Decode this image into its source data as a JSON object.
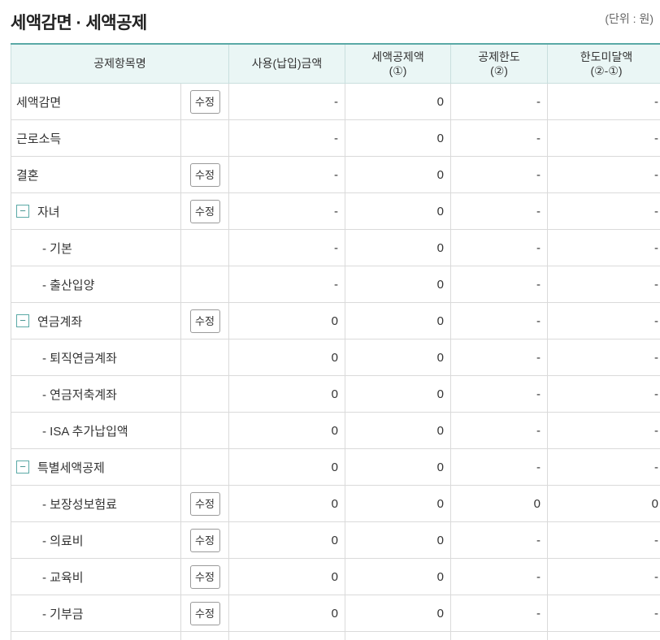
{
  "header": {
    "title": "세액감면 · 세액공제",
    "unit": "(단위 : 원)"
  },
  "table": {
    "columns": {
      "item": "공제항목명",
      "paid": "사용(납입)금액",
      "credit": "세액공제액",
      "credit_note": "(①)",
      "limit": "공제한도",
      "limit_note": "(②)",
      "remaining": "한도미달액",
      "remaining_note": "(②-①)"
    },
    "edit_label": "수정",
    "toggle_symbol": "−",
    "rows": [
      {
        "label": "세액감면",
        "paid": "-",
        "credit": "0",
        "limit": "-",
        "remaining": "-"
      },
      {
        "label": "근로소득",
        "paid": "-",
        "credit": "0",
        "limit": "-",
        "remaining": "-"
      },
      {
        "label": "결혼",
        "paid": "-",
        "credit": "0",
        "limit": "-",
        "remaining": "-"
      },
      {
        "label": "자녀",
        "paid": "-",
        "credit": "0",
        "limit": "-",
        "remaining": "-"
      },
      {
        "label": "- 기본",
        "paid": "-",
        "credit": "0",
        "limit": "-",
        "remaining": "-"
      },
      {
        "label": "- 출산입양",
        "paid": "-",
        "credit": "0",
        "limit": "-",
        "remaining": "-"
      },
      {
        "label": "연금계좌",
        "paid": "0",
        "credit": "0",
        "limit": "-",
        "remaining": "-"
      },
      {
        "label": "- 퇴직연금계좌",
        "paid": "0",
        "credit": "0",
        "limit": "-",
        "remaining": "-"
      },
      {
        "label": "- 연금저축계좌",
        "paid": "0",
        "credit": "0",
        "limit": "-",
        "remaining": "-"
      },
      {
        "label": "- ISA 추가납입액",
        "paid": "0",
        "credit": "0",
        "limit": "-",
        "remaining": "-"
      },
      {
        "label": "특별세액공제",
        "paid": "0",
        "credit": "0",
        "limit": "-",
        "remaining": "-"
      },
      {
        "label": "- 보장성보험료",
        "paid": "0",
        "credit": "0",
        "limit": "0",
        "remaining": "0"
      },
      {
        "label": "- 의료비",
        "paid": "0",
        "credit": "0",
        "limit": "-",
        "remaining": "-"
      },
      {
        "label": "- 교육비",
        "paid": "0",
        "credit": "0",
        "limit": "-",
        "remaining": "-"
      },
      {
        "label": "- 기부금",
        "paid": "0",
        "credit": "0",
        "limit": "-",
        "remaining": "-"
      },
      {
        "label": "",
        "paid": "",
        "credit": "",
        "limit": "",
        "remaining": ""
      }
    ]
  },
  "colors": {
    "header_bg": "#eaf6f5",
    "accent": "#5aa9a6",
    "border": "#dadada"
  },
  "icons": {
    "toggle": "collapse-minus-icon"
  }
}
